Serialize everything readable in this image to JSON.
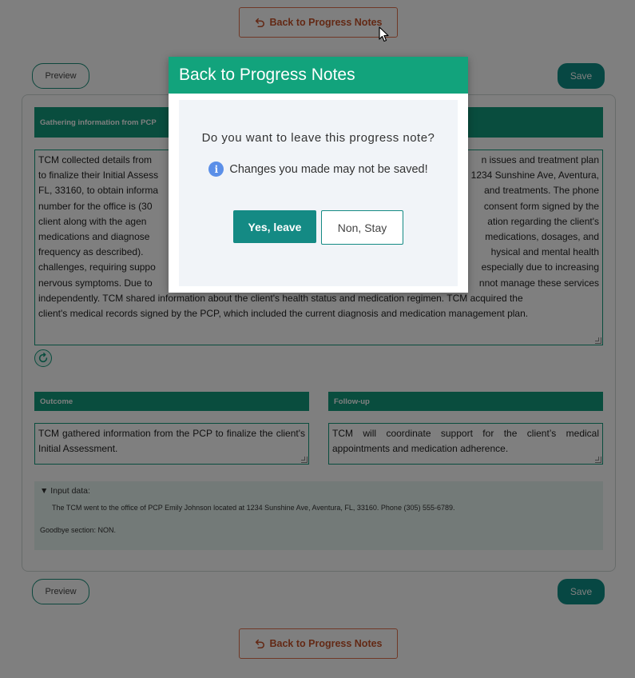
{
  "back_button_label": "Back to Progress Notes",
  "preview_label": "Preview",
  "save_label": "Save",
  "gathering_section": {
    "title": "Gathering information from PCP",
    "lines": [
      "TCM collected details from",
      "n issues and treatment plan",
      "to finalize their Initial Assess",
      "1234 Sunshine Ave, Aventura,",
      "FL, 33160, to obtain informa",
      "and treatments. The phone",
      "number for the office is (30",
      "consent form signed by the",
      "client along with the agen",
      "ation regarding the client's",
      "medications and diagnose",
      "medications, dosages, and",
      "frequency as described).",
      "hysical and mental health",
      "challenges, requiring suppo",
      "especially due to increasing",
      "nervous symptoms. Due to",
      "nnot manage these services",
      "independently. TCM shared information about the client's health status and medication regimen. TCM acquired the",
      "client's medical records signed by the PCP, which included the current diagnosis and medication management plan."
    ]
  },
  "outcome": {
    "title": "Outcome",
    "text": "TCM gathered information from the PCP to finalize the client's Initial Assessment."
  },
  "follow_up": {
    "title": "Follow-up",
    "text": "TCM will coordinate support for the client’s medical appointments and medication adherence."
  },
  "input_data": {
    "summary": "▼ Input data:",
    "line1": "The TCM went to the office of PCP Emily Johnson located at 1234 Sunshine Ave, Aventura, FL, 33160. Phone (305) 555-6789.",
    "line2": "Goodbye section: NON."
  },
  "modal": {
    "title": "Back to Progress Notes",
    "question": "Do you want to leave this progress note?",
    "warning": "Changes you made may not be saved!",
    "info_icon_char": "i",
    "yes_label": "Yes, leave",
    "stay_label": "Non, Stay"
  },
  "colors": {
    "accent": "#129a7c",
    "modal_header": "#12a37c",
    "back_button_text": "#c6532a",
    "save_button": "#0f8f86",
    "info_icon": "#5b8fe8"
  }
}
